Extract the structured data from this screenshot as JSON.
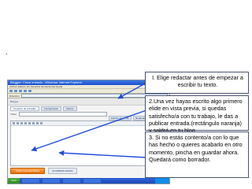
{
  "slide": {
    "bullet": "."
  },
  "browser": {
    "title": "Blogger: Crear entrada - Windows Internet Explorer",
    "menu": "Archivo  Edición  Ver  Favoritos  Herramientas  Ayuda",
    "address_label": "Dirección",
    "address": "",
    "blogger_header": "Blogger",
    "tabs": [
      "Creación de entradas",
      "Configuración",
      "Diseño"
    ],
    "title_label": "Título:",
    "editor_tabs": [
      "Edición de HTML",
      "Redactar"
    ],
    "publish_label": "PUBLICAR ENTRADA",
    "save_label": "GUARDAR AHORA",
    "start_label": "Inicio",
    "taskbar_items": [
      "",
      "",
      "",
      ""
    ]
  },
  "callouts": {
    "step1": "I. Elige redactar antes de empezar a escribir tu texto.",
    "step2": "2.Una vez hayas escrito algo primero elide en vista previa, si quedas satisfecho/a con tu trabajo, le das a publicar entrada.(rectángulo naranja) y saldrá en tu blog.",
    "step3": "3. Si no estás contento/a con lo que has hecho o quieres acabarlo en otro momento, pincha en guardar ahora. Quedará como borrador."
  },
  "colors": {
    "arrow": "#1f4fd8",
    "publish_button": "#e8700a",
    "callout_border": "#4a5470"
  }
}
